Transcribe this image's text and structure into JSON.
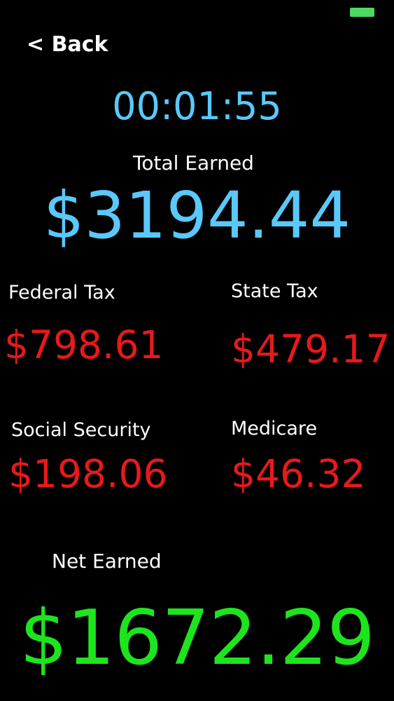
{
  "colors": {
    "background": "#000000",
    "label": "#ffffff",
    "accent_blue": "#5ac8fa",
    "tax_red": "#e8191b",
    "net_green": "#1ee41e",
    "battery_green": "#4cd964"
  },
  "nav": {
    "back_label": "< Back"
  },
  "timer": {
    "elapsed": "00:01:55"
  },
  "total": {
    "label": "Total Earned",
    "value": "$3194.44"
  },
  "deductions": {
    "federal": {
      "label": "Federal Tax",
      "value": "$798.61"
    },
    "state": {
      "label": "State Tax",
      "value": "$479.17"
    },
    "social_security": {
      "label": "Social Security",
      "value": "$198.06"
    },
    "medicare": {
      "label": "Medicare",
      "value": "$46.32"
    }
  },
  "net": {
    "label": "Net Earned",
    "value": "$1672.29"
  }
}
